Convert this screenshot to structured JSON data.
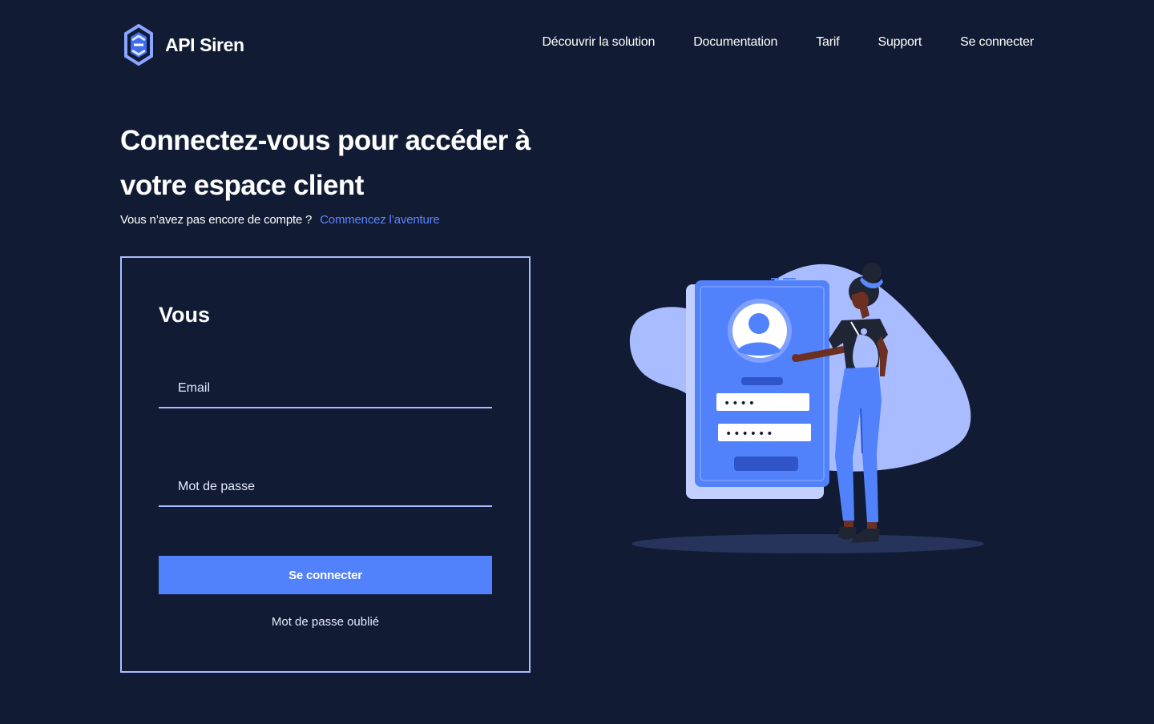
{
  "brand": {
    "name": "API Siren",
    "icon": "api-siren-logo-icon"
  },
  "nav": {
    "items": [
      "Découvrir la solution",
      "Documentation",
      "Tarif",
      "Support",
      "Se connecter"
    ]
  },
  "hero": {
    "title": "Connectez-vous pour accéder à votre espace client",
    "subtitle": "Vous n’avez pas encore de compte ?",
    "signup_link": "Commencez l’aventure"
  },
  "login": {
    "title": "Vous",
    "email_placeholder": "Email",
    "email_value": "",
    "password_placeholder": "Mot de passe",
    "password_value": "",
    "submit_label": "Se connecter",
    "forgot_label": "Mot de passe oublié"
  },
  "illustration": {
    "icon": "login-illustration",
    "masked_field_1": "••••",
    "masked_field_2": "••••••"
  },
  "colors": {
    "background": "#111b33",
    "accent": "#5182fb",
    "link": "#5b87ff",
    "border": "#a9bcff",
    "text": "#ffffff"
  }
}
